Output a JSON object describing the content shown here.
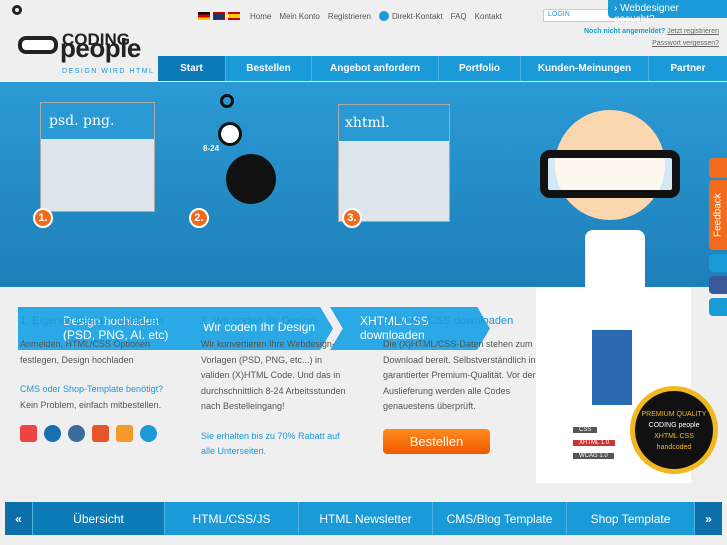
{
  "logo": {
    "line1": "CODING",
    "line2": "people",
    "tagline": "DESIGN WIRD HTML"
  },
  "topbar": {
    "flags": [
      "de",
      "en",
      "es"
    ],
    "links": [
      "Home",
      "Mein Konto",
      "Registrieren",
      "Direkt-Kontakt",
      "FAQ",
      "Kontakt"
    ],
    "login_placeholder": "LOGIN",
    "not_logged": "Noch nicht angemeldet?",
    "register": "Jetzt registrieren",
    "forgot": "Passwort vergessen?",
    "webdesigner": "› Webdesigner gesucht?"
  },
  "nav": [
    "Start",
    "Bestellen",
    "Angebot anfordern",
    "Portfolio",
    "Kunden-Meinungen",
    "Partner"
  ],
  "hero": {
    "shot1": "psd. png.",
    "shot2": "xhtml.",
    "hours": "8-24",
    "steps": [
      {
        "n": "1.",
        "text": "Design hochladen (PSD, PNG, AI. etc)"
      },
      {
        "n": "2.",
        "text": "Wir coden Ihr Design"
      },
      {
        "n": "3.",
        "text": "XHTML/CSS downloaden"
      }
    ]
  },
  "cols": [
    {
      "title": "1. Eigenes Design hochladen",
      "text": "Anmelden, HTML/CSS Optionen festlegen, Design hochladen",
      "link": "CMS oder Shop-Template benötigt?",
      "text2": "Kein Problem, einfach mitbestellen."
    },
    {
      "title": "2. Wir coden Ihr Design",
      "text": "Wir konvertieren Ihre Webdesign-Vorlagen (PSD, PNG, etc...) in validen (X)HTML Code. Und das in durchschnittlich 8-24 Arbeitsstunden nach Bestelleingang!",
      "link": "Sie erhalten bis zu 70% Rabatt auf alle Unterseiten."
    },
    {
      "title": "3. HTML/CSS downloaden",
      "text": "Die (X)HTML/CSS-Daten stehen zum Download bereit. Selbstverständlich in garantierter Premium-Qualität. Vor der Auslieferung werden alle Codes genauestens überprüft.",
      "button": "Bestellen"
    }
  ],
  "cms_icons": [
    "joomla",
    "drupal",
    "wordpress",
    "magento",
    "oscommerce",
    "shopware"
  ],
  "badges": [
    "CSS",
    "XHTML 1.0",
    "WCAG 1.0"
  ],
  "seal": {
    "top": "PREMIUM QUALITY",
    "mid": "CODING people",
    "sub": "XHTML CSS",
    "bottom": "handcoded"
  },
  "feedback": "Feedback",
  "bottom_tabs": [
    "Übersicht",
    "HTML/CSS/JS",
    "HTML Newsletter",
    "CMS/Blog Template",
    "Shop Template"
  ],
  "colors": {
    "blue": "#1a9ad6",
    "orange": "#f26b1d"
  }
}
